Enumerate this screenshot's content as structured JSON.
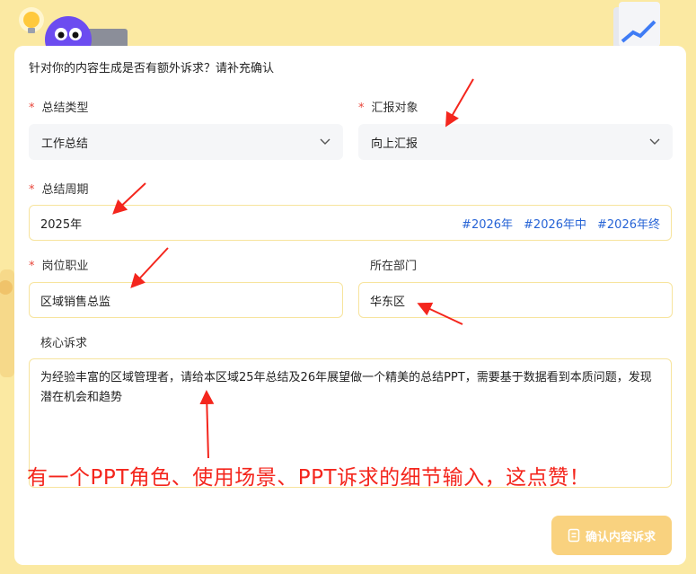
{
  "form": {
    "title": "针对你的内容生成是否有额外诉求？请补充确认",
    "required_mark": "*",
    "summary_type": {
      "label": "总结类型",
      "value": "工作总结"
    },
    "report_target": {
      "label": "汇报对象",
      "value": "向上汇报"
    },
    "summary_period": {
      "label": "总结周期",
      "value": "2025年",
      "tags": [
        "#2026年",
        "#2026年中",
        "#2026年终"
      ]
    },
    "position": {
      "label": "岗位职业",
      "value": "区域销售总监"
    },
    "department": {
      "label": "所在部门",
      "value": "华东区"
    },
    "core_request": {
      "label": "核心诉求",
      "value": "为经验丰富的区域管理者，请给本区域25年总结及26年展望做一个精美的总结PPT，需要基于数据看到本质问题，发现潜在机会和趋势"
    },
    "confirm_button": "确认内容诉求"
  },
  "annotation": "有一个PPT角色、使用场景、PPT诉求的细节输入，这点赞！",
  "colors": {
    "background": "#fbe9a2",
    "required": "#e8463b",
    "tag": "#2764d6",
    "annotation": "#f4261d",
    "button": "#f9d27f",
    "input_border": "#f7e49d"
  }
}
